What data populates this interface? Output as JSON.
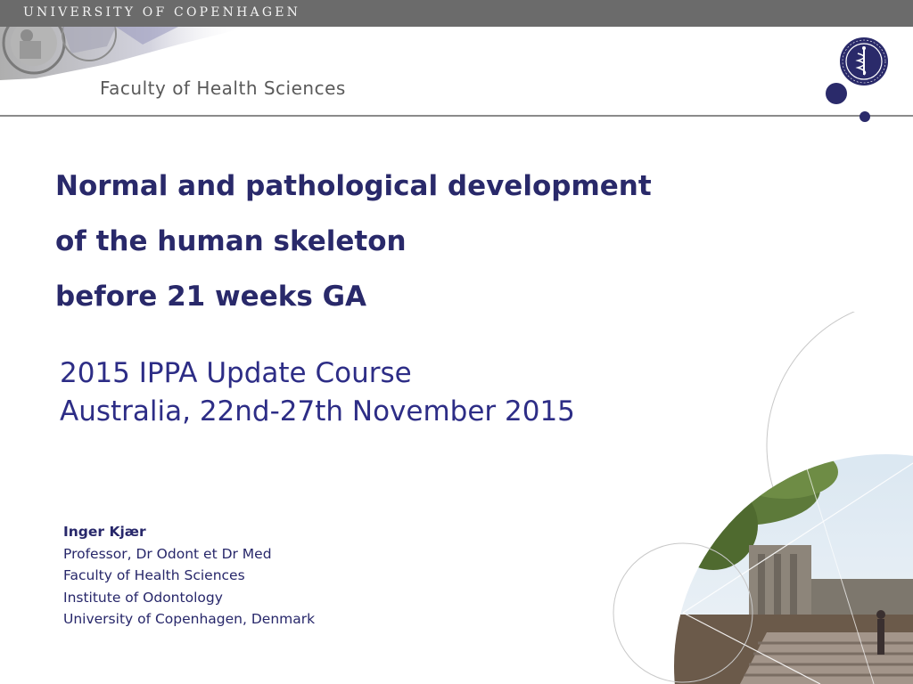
{
  "header": {
    "university": "UNIVERSITY OF COPENHAGEN",
    "faculty": "Faculty of Health Sciences",
    "bar_color": "#6b6b6b",
    "accent_color": "#29296a"
  },
  "title_lines": [
    "Normal and pathological development",
    "of the human skeleton",
    "before 21 weeks GA"
  ],
  "subtitle_lines": [
    "2015 IPPA Update Course",
    "Australia, 22nd-27th November 2015"
  ],
  "author": {
    "name": "Inger Kjær",
    "lines": [
      "Professor, Dr Odont et Dr Med",
      "Faculty of Health Sciences",
      "Institute of Odontology",
      "University of Copenhagen, Denmark"
    ]
  },
  "graphics": {
    "seal_icon": "university-seal",
    "logo_icon": "faculty-seal-logo",
    "photo": "campus-building-photo"
  }
}
